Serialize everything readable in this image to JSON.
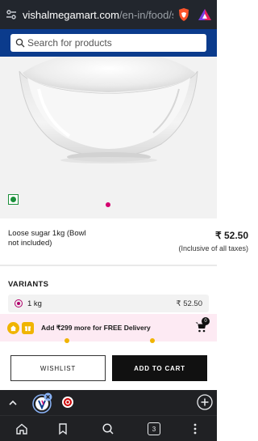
{
  "browser": {
    "url_domain": "vishalmegamart.com",
    "url_path": "/en-in/food/s",
    "tab_count": "3"
  },
  "search": {
    "placeholder": "Search for products"
  },
  "product": {
    "name": "Loose sugar 1kg (Bowl not included)",
    "price": "₹ 52.50",
    "tax_note": "(Inclusive of all taxes)",
    "image_carousel": {
      "total_dots": 1,
      "active_index": 0
    }
  },
  "variants": {
    "heading": "VARIANTS",
    "items": [
      {
        "label": "1 kg",
        "price": "₹ 52.50",
        "selected": true
      }
    ]
  },
  "delivery_banner": {
    "message": "Add ₹299 more for FREE Delivery",
    "cart_count": "0"
  },
  "actions": {
    "wishlist_label": "WISHLIST",
    "add_to_cart_label": "ADD TO CART"
  },
  "colors": {
    "header_blue": "#0b3b8c",
    "accent_pink": "#d4006f",
    "veg_green": "#1b8f3a",
    "banner_bg": "#fdeaf3",
    "banner_icon_yellow": "#f0b400"
  },
  "icons": {
    "url_bar_left": "tune-icon",
    "brave": "brave-shield-icon",
    "rewards": "brave-rewards-icon",
    "search": "search-icon",
    "veg": "veg-mark-icon",
    "banner": [
      "home-icon",
      "gift-icon"
    ],
    "cart": "cart-icon",
    "tab_strip": [
      "chevron-up-icon",
      "vishal-favicon-icon",
      "close-badge-icon",
      "target-favicon-icon",
      "new-tab-plus-icon"
    ],
    "bottom_nav": [
      "home-icon",
      "bookmark-icon",
      "search-icon",
      "tabs-icon",
      "menu-icon"
    ]
  }
}
